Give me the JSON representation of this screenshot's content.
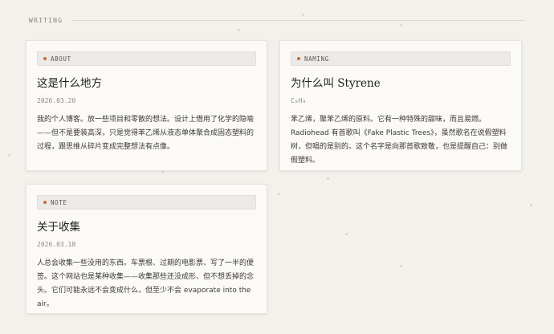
{
  "section": {
    "label": "WRITING"
  },
  "cards": [
    {
      "tag": "ABOUT",
      "title": "这是什么地方",
      "date": "2026.03.20",
      "body": "我的个人博客。放一些项目和零散的想法。设计上借用了化学的隐喻——但不是要装高深，只是觉得苯乙烯从液态单体聚合成固态塑料的过程，跟思维从碎片变成完整想法有点像。"
    },
    {
      "tag": "NAMING",
      "title": "为什么叫 Styrene",
      "date": "C₈H₈",
      "body": "苯乙烯，聚苯乙烯的原料。它有一种特殊的甜味，而且易燃。Radiohead 有首歌叫《Fake Plastic Trees》，虽然歌名在说假塑料树，但唱的是别的。这个名字是向那首歌致敬，也是提醒自己：别做假塑料。"
    },
    {
      "tag": "NOTE",
      "title": "关于收集",
      "date": "2026.03.18",
      "body": "人总会收集一些没用的东西。车票根、过期的电影票、写了一半的便签。这个网站也是某种收集——收集那些还没成形、但不想丢掉的念头。它们可能永远不会变成什么，但至少不会 evaporate into the air。"
    }
  ]
}
